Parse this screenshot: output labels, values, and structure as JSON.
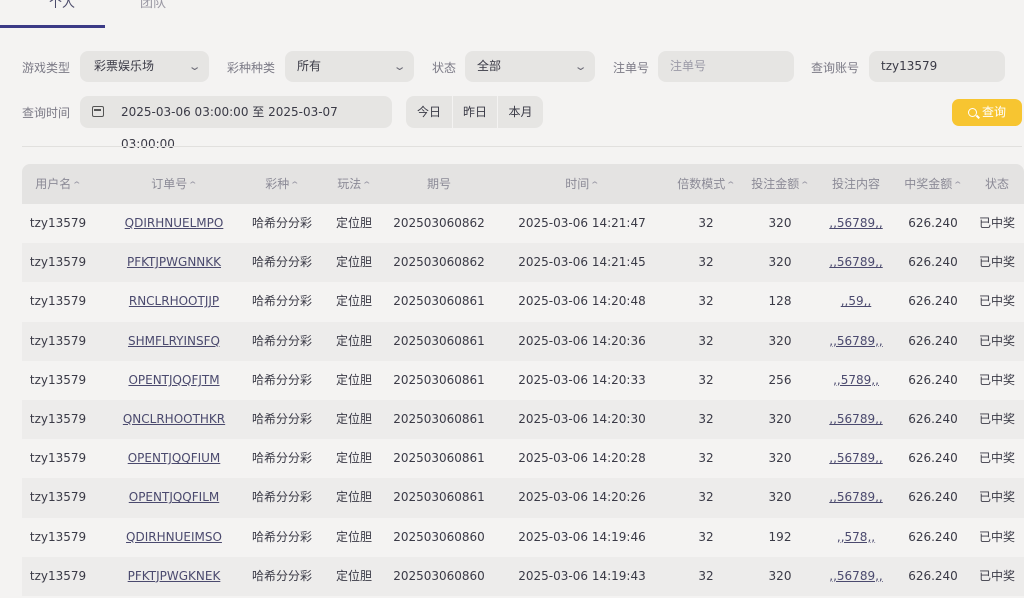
{
  "tabs": [
    {
      "label": "个人"
    },
    {
      "label": "团队"
    }
  ],
  "filters": {
    "game_type_label": "游戏类型",
    "game_type_value": "彩票娱乐场",
    "lottery_kind_label": "彩种种类",
    "lottery_kind_value": "所有",
    "status_label": "状态",
    "status_value": "全部",
    "order_no_label": "注单号",
    "order_no_placeholder": "注单号",
    "account_label": "查询账号",
    "account_value": "tzy13579",
    "time_label": "查询时间",
    "date_range": "2025-03-06 03:00:00 至 2025-03-07 03:00:00",
    "quick_today": "今日",
    "quick_yesterday": "昨日",
    "quick_month": "本月",
    "query_button": "查询"
  },
  "table": {
    "headers": [
      "用户名",
      "订单号",
      "彩种",
      "玩法",
      "期号",
      "时间",
      "倍数模式",
      "投注金额",
      "投注内容",
      "中奖金额",
      "状态"
    ],
    "rows": [
      [
        "tzy13579",
        "QDIRHNUELMPO",
        "哈希分分彩",
        "定位胆",
        "202503060862",
        "2025-03-06 14:21:47",
        "32",
        "320",
        ",,56789,,",
        "626.240",
        "已中奖"
      ],
      [
        "tzy13579",
        "PFKTJPWGNNKK",
        "哈希分分彩",
        "定位胆",
        "202503060862",
        "2025-03-06 14:21:45",
        "32",
        "320",
        ",,56789,,",
        "626.240",
        "已中奖"
      ],
      [
        "tzy13579",
        "RNCLRHOOTJJP",
        "哈希分分彩",
        "定位胆",
        "202503060861",
        "2025-03-06 14:20:48",
        "32",
        "128",
        ",,59,,",
        "626.240",
        "已中奖"
      ],
      [
        "tzy13579",
        "SHMFLRYINSFQ",
        "哈希分分彩",
        "定位胆",
        "202503060861",
        "2025-03-06 14:20:36",
        "32",
        "320",
        ",,56789,,",
        "626.240",
        "已中奖"
      ],
      [
        "tzy13579",
        "OPENTJQQFJTM",
        "哈希分分彩",
        "定位胆",
        "202503060861",
        "2025-03-06 14:20:33",
        "32",
        "256",
        ",,5789,,",
        "626.240",
        "已中奖"
      ],
      [
        "tzy13579",
        "QNCLRHOOTHKR",
        "哈希分分彩",
        "定位胆",
        "202503060861",
        "2025-03-06 14:20:30",
        "32",
        "320",
        ",,56789,,",
        "626.240",
        "已中奖"
      ],
      [
        "tzy13579",
        "OPENTJQQFIUM",
        "哈希分分彩",
        "定位胆",
        "202503060861",
        "2025-03-06 14:20:28",
        "32",
        "320",
        ",,56789,,",
        "626.240",
        "已中奖"
      ],
      [
        "tzy13579",
        "OPENTJQQFILM",
        "哈希分分彩",
        "定位胆",
        "202503060861",
        "2025-03-06 14:20:26",
        "32",
        "320",
        ",,56789,,",
        "626.240",
        "已中奖"
      ],
      [
        "tzy13579",
        "QDIRHNUEIMSO",
        "哈希分分彩",
        "定位胆",
        "202503060860",
        "2025-03-06 14:19:46",
        "32",
        "192",
        ",,578,,",
        "626.240",
        "已中奖"
      ],
      [
        "tzy13579",
        "PFKTJPWGKNEK",
        "哈希分分彩",
        "定位胆",
        "202503060860",
        "2025-03-06 14:19:43",
        "32",
        "320",
        ",,56789,,",
        "626.240",
        "已中奖"
      ]
    ]
  },
  "colors": {
    "accent": "#3b3a86",
    "query_button": "#f7c531"
  }
}
